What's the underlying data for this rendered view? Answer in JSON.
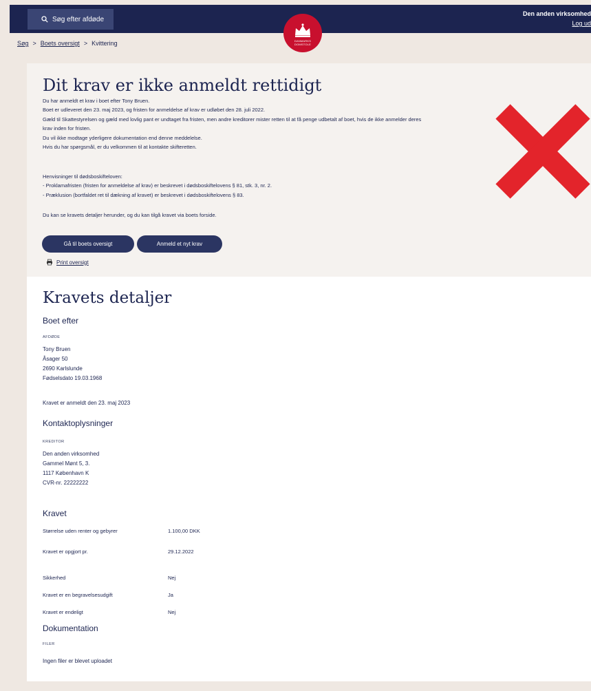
{
  "header": {
    "search_label": "Søg efter afdøde",
    "user_name": "Den anden virksomhed",
    "logout_label": "Log ud",
    "logo_text": "DANMARKS DOMSTOLE"
  },
  "breadcrumb": {
    "items": [
      "Søg",
      "Boets oversigt",
      "Kvittering"
    ],
    "separator": ">"
  },
  "receipt": {
    "title": "Dit krav er ikke anmeldt rettidigt",
    "paragraphs": [
      "Du har anmeldt et krav i boet efter Tony Bruen.",
      "Boet er udleveret den 23. maj 2023, og fristen for anmeldelse af krav er udløbet den 28. juli 2022.",
      "Gæld til Skattestyrelsen og gæld med lovlig pant er undtaget fra fristen, men andre kreditorer mister retten til at få penge udbetalt af boet, hvis de ikke anmelder deres",
      "krav inden for fristen.",
      "Du vil ikke modtage yderligere dokumentation end denne meddelelse.",
      "Hvis du har spørgsmål, er du velkommen til at kontakte skifteretten."
    ],
    "references_heading": "Henvisninger til dødsboskifteloven:",
    "references": [
      "- Proklamafristen (fristen for anmeldelse af krav) er beskrevet i dødsboskiftelovens § 81, stk. 3, nr. 2.",
      "- Præklusion (bortfaldet ret til dækning af kravet) er beskrevet i dødsboskiftelovens § 83."
    ],
    "closing": "Du kan se kravets detaljer herunder, og du kan tilgå kravet via boets forside.",
    "button_overview": "Gå til boets oversigt",
    "button_new_claim": "Anmeld et nyt krav",
    "print_label": "Print oversigt"
  },
  "details": {
    "title": "Kravets detaljer",
    "estate_heading": "Boet efter",
    "deceased_caption": "AFDØDE",
    "deceased": {
      "name": "Tony Bruen",
      "street": "Åsager 50",
      "city": "2690 Karlslunde",
      "birth": "Fødselsdato 19.03.1968"
    },
    "filed_text": "Kravet er anmeldt den 23. maj 2023",
    "contact_heading": "Kontaktoplysninger",
    "creditor_caption": "KREDITOR",
    "creditor": {
      "name": "Den anden virksomhed",
      "street": "Gammel Mønt 5, 3.",
      "city": "1117 København K",
      "cvr": "CVR-nr. 22222222"
    },
    "claim_heading": "Kravet",
    "claim_rows": [
      {
        "label": "Størrelse uden renter og gebyrer",
        "value": "1.100,00 DKK"
      },
      {
        "label": "Kravet er opgjort pr.",
        "value": "29.12.2022"
      },
      {
        "label": "Sikkerhed",
        "value": "Nej"
      },
      {
        "label": "Kravet er en begravelsesudgift",
        "value": "Ja"
      },
      {
        "label": "Kravet er endeligt",
        "value": "Nej"
      }
    ],
    "documentation_heading": "Dokumentation",
    "files_caption": "FILER",
    "no_files": "Ingen filer er blevet uploadet"
  },
  "colors": {
    "navy": "#1c2450",
    "brand_red": "#c8102e",
    "x_mark": "#e3242b",
    "page_bg": "#efe8e2"
  }
}
